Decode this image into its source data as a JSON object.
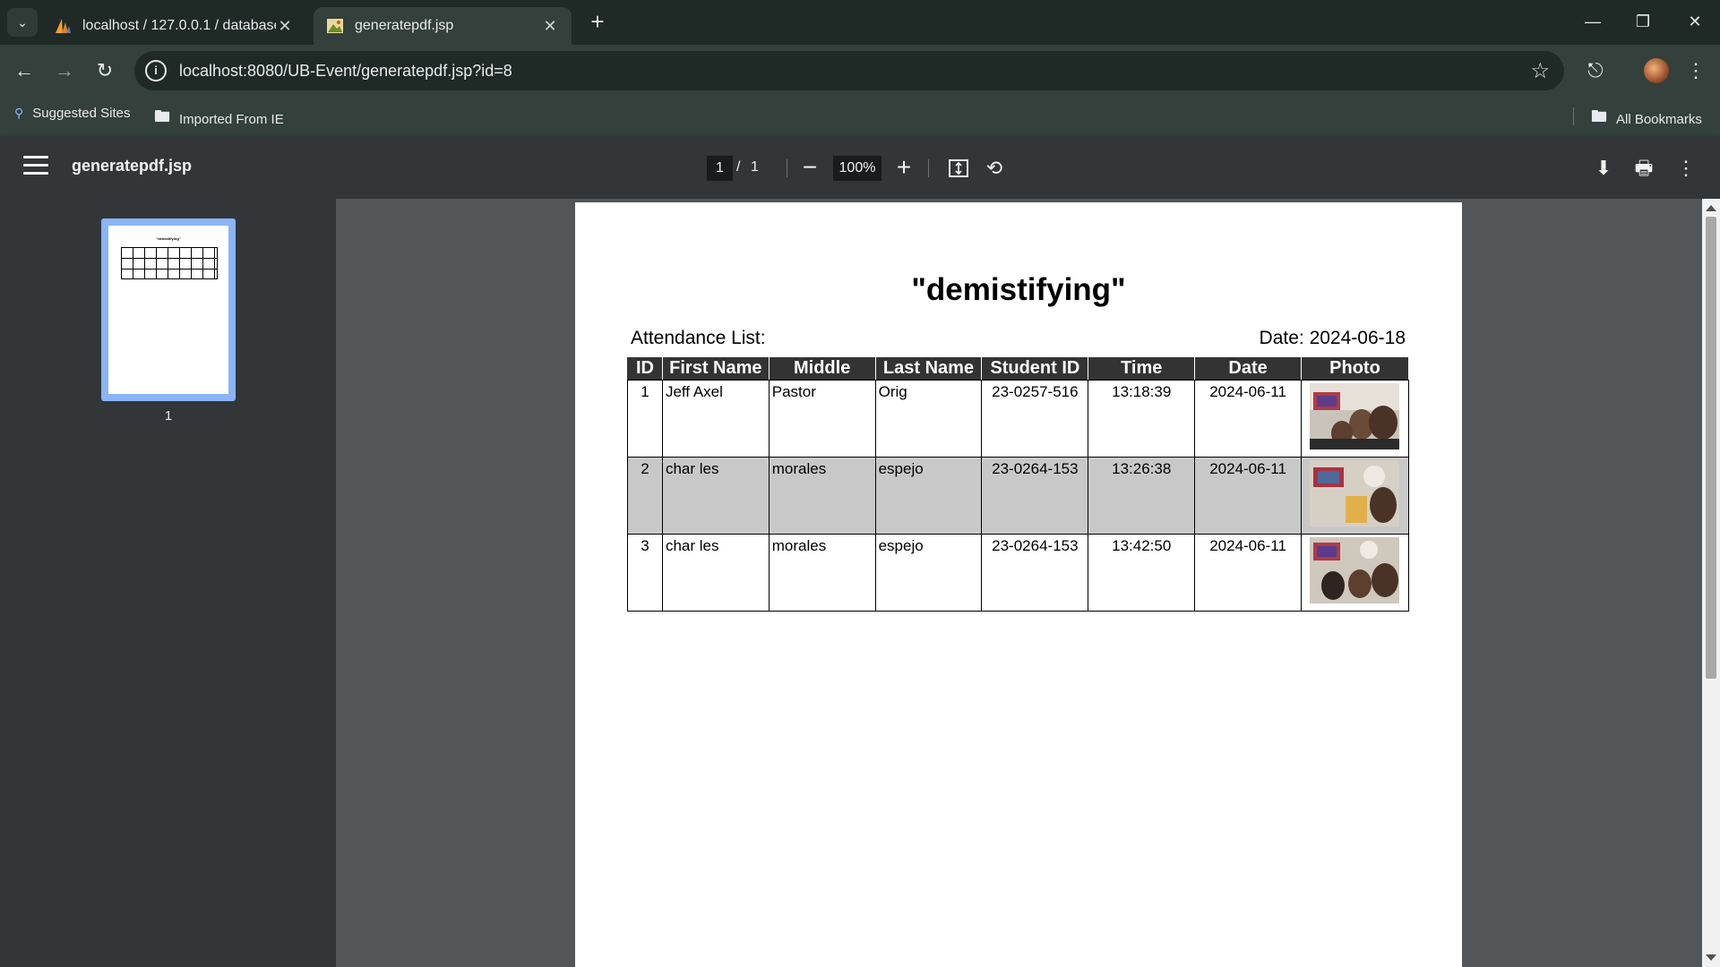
{
  "browser": {
    "tabs": [
      {
        "title": "localhost / 127.0.0.1 / database",
        "active": false
      },
      {
        "title": "generatepdf.jsp",
        "active": true
      }
    ],
    "url": "localhost:8080/UB-Event/generatepdf.jsp?id=8",
    "bookmarks": {
      "suggested": "Suggested Sites",
      "imported": "Imported From IE",
      "all": "All Bookmarks"
    }
  },
  "viewer": {
    "title": "generatepdf.jsp",
    "page_current": "1",
    "page_sep": "/",
    "page_total": "1",
    "zoom": "100%",
    "thumbnail_label": "1"
  },
  "document": {
    "title": "\"demistifying\"",
    "thumb_title": "\"demistifying\"",
    "attendance_label": "Attendance List:",
    "date_label": "Date: 2024-06-18",
    "headers": [
      "ID",
      "First Name",
      "Middle",
      "Last Name",
      "Student ID",
      "Time",
      "Date",
      "Photo"
    ],
    "rows": [
      {
        "id": "1",
        "first": "Jeff Axel",
        "middle": "Pastor",
        "last": "Orig",
        "student_id": "23-0257-516",
        "time": "13:18:39",
        "date": "2024-06-11"
      },
      {
        "id": "2",
        "first": "char les",
        "middle": "morales",
        "last": "espejo",
        "student_id": "23-0264-153",
        "time": "13:26:38",
        "date": "2024-06-11"
      },
      {
        "id": "3",
        "first": "char les",
        "middle": "morales",
        "last": "espejo",
        "student_id": "23-0264-153",
        "time": "13:42:50",
        "date": "2024-06-11"
      }
    ]
  }
}
